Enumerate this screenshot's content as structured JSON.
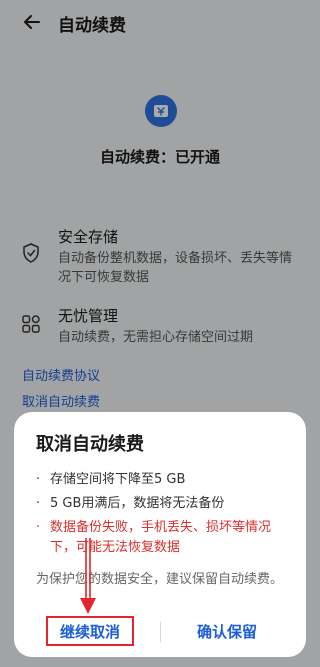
{
  "header": {
    "title": "自动续费"
  },
  "hero": {
    "status": "自动续费：已开通"
  },
  "features": [
    {
      "title": "安全存储",
      "desc": "自动备份整机数据，设备损坏、丢失等情况下可恢复数据"
    },
    {
      "title": "无忧管理",
      "desc": "自动续费，无需担心存储空间过期"
    }
  ],
  "links": {
    "agreement": "自动续费协议",
    "cancel": "取消自动续费"
  },
  "dialog": {
    "title": "取消自动续费",
    "bullets": [
      "存储空间将下降至5 GB",
      "5 GB用满后，数据将无法备份",
      "数据备份失败，手机丢失、损坏等情况下，可能无法恢复数据"
    ],
    "note": "为保护您的数据安全，建议保留自动续费。",
    "continue_cancel": "继续取消",
    "keep": "确认保留"
  },
  "colors": {
    "accent": "#1d5fd6",
    "warning": "#d9302c",
    "highlight": "#e3262c"
  },
  "icons": {
    "back": "back-arrow-icon",
    "hero": "ticket-yen-icon",
    "shield": "shield-check-icon",
    "grid": "grid-icon"
  }
}
